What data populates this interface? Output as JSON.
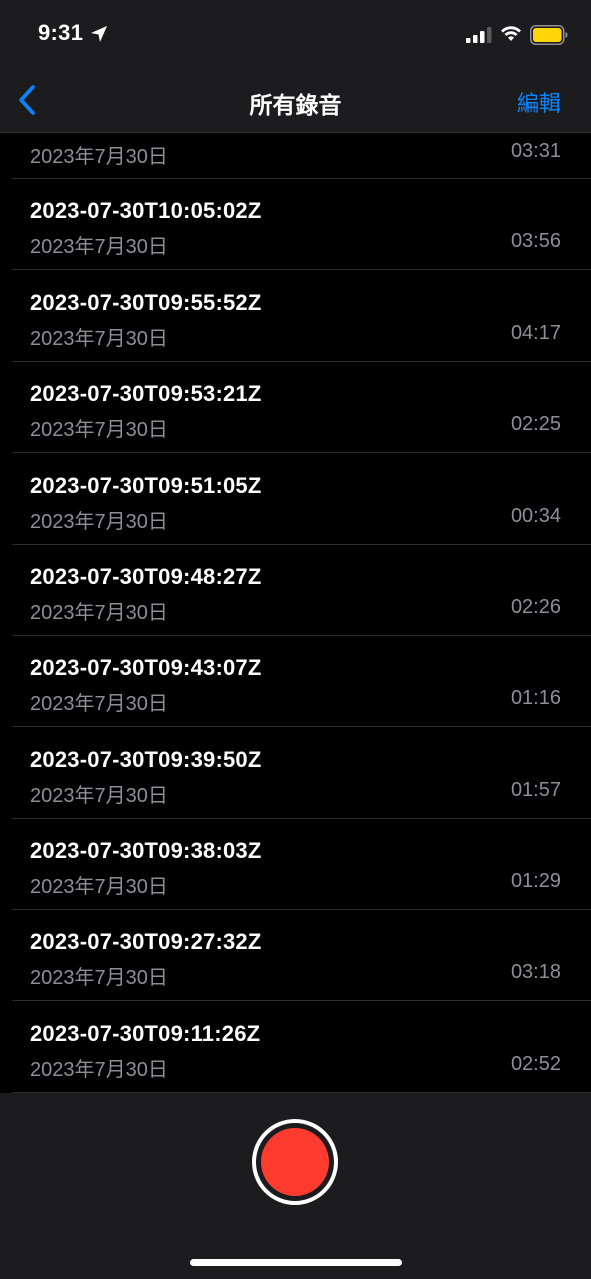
{
  "status_bar": {
    "time": "9:31",
    "icons": [
      "location-arrow-icon",
      "cellular-signal-icon",
      "wifi-icon",
      "battery-icon"
    ],
    "battery_color": "#ffd60a"
  },
  "nav": {
    "back_icon": "chevron-left-icon",
    "title": "所有錄音",
    "edit_label": "編輯",
    "accent": "#0a84ff"
  },
  "partial_row": {
    "date": "2023年7月30日",
    "duration": "03:31"
  },
  "recordings": [
    {
      "title": "2023-07-30T10:05:02Z",
      "date": "2023年7月30日",
      "duration": "03:56"
    },
    {
      "title": "2023-07-30T09:55:52Z",
      "date": "2023年7月30日",
      "duration": "04:17"
    },
    {
      "title": "2023-07-30T09:53:21Z",
      "date": "2023年7月30日",
      "duration": "02:25"
    },
    {
      "title": "2023-07-30T09:51:05Z",
      "date": "2023年7月30日",
      "duration": "00:34"
    },
    {
      "title": "2023-07-30T09:48:27Z",
      "date": "2023年7月30日",
      "duration": "02:26"
    },
    {
      "title": "2023-07-30T09:43:07Z",
      "date": "2023年7月30日",
      "duration": "01:16"
    },
    {
      "title": "2023-07-30T09:39:50Z",
      "date": "2023年7月30日",
      "duration": "01:57"
    },
    {
      "title": "2023-07-30T09:38:03Z",
      "date": "2023年7月30日",
      "duration": "01:29"
    },
    {
      "title": "2023-07-30T09:27:32Z",
      "date": "2023年7月30日",
      "duration": "03:18"
    },
    {
      "title": "2023-07-30T09:11:26Z",
      "date": "2023年7月30日",
      "duration": "02:52"
    }
  ],
  "record_button": {
    "icon": "record-icon",
    "color": "#ff3b30"
  }
}
